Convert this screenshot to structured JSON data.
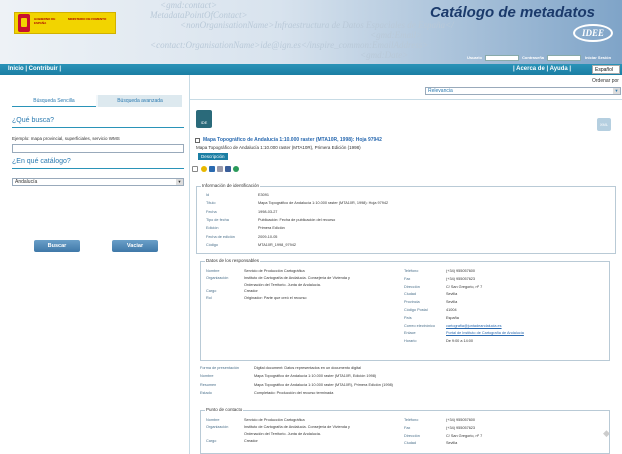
{
  "header": {
    "xml_lines": [
      "<gmd:contact>",
      "MetadataPointOfContact>",
      "<nonOrganisationName>Infraestructura de Datos Espaciales de España</",
      "<gmd:Email>",
      "<contact:OrganisationName>ide@ign.es</inspire_common:EmailAddress>",
      "<gmd:Date>"
    ],
    "logo_line1": "GOBIERNO DE ESPAÑA",
    "logo_line2": "MINISTERIO DE FOMENTO",
    "title": "Catálogo de metadatos",
    "idee": "IDEE",
    "login": {
      "user_label": "Usuario",
      "pass_label": "Contraseña",
      "login_link": "Iniciar Sesión"
    }
  },
  "nav": {
    "left": "Inicio | Contribuir |",
    "right": "| Acerca de | Ayuda |",
    "lang": "Español"
  },
  "left": {
    "tabs": [
      "Búsqueda Sencilla",
      "Búsqueda avanzada"
    ],
    "q1": "¿Qué busca?",
    "example": "Ejemplo: mapa provincial, superficiales, servicio WMS",
    "search_value": "",
    "q2": "¿En qué catálogo?",
    "catalog": "Andalucía",
    "btn_search": "Buscar",
    "btn_clear": "Vaciar"
  },
  "right": {
    "order_label": "Ordenar por",
    "order_value": "Relevancia",
    "doc_icon": "IDE",
    "xml_icon": "XML",
    "result_title": "Mapa Topográfico de Andalucía 1:10.000 raster (MTA10R, 1998): Hoja 97942",
    "result_sub": "Mapa Topográfico de Andalucía 1:10.000 raster (MTA10R), Primera Edición (1998)",
    "desc_button": "Descripción",
    "ident": {
      "legend": "Información de identificación",
      "rows": [
        {
          "k": "Id",
          "v": "E3091"
        },
        {
          "k": "Título",
          "v": "Mapa Topográfico de Andalucía 1:10.000 raster (MTA10R, 1998): Hoja 97942"
        },
        {
          "k": "Fecha",
          "v": "1998-03-27"
        },
        {
          "k": "Tipo de fecha",
          "v": "Publicación: Fecha de publicación del recurso"
        },
        {
          "k": "Edición",
          "v": "Primera Edición"
        },
        {
          "k": "Fecha de edición",
          "v": "2009-10-05"
        },
        {
          "k": "Código",
          "v": "MTA10R_1998_97942"
        }
      ]
    },
    "resp": {
      "legend": "Datos de los responsables",
      "left": [
        {
          "k": "Nombre",
          "v": "Servicio de Producción Cartográfica"
        },
        {
          "k": "Organización",
          "v": "Instituto de Cartografía de Andalucía. Consejería de Vivienda y"
        },
        {
          "k": "",
          "v": "Ordenación del Territorio. Junta de Andalucía."
        },
        {
          "k": "Cargo",
          "v": "Creador"
        },
        {
          "k": "Rol",
          "v": "Originador: Parte que creó el recurso"
        }
      ],
      "right": [
        {
          "k": "Teléfono",
          "v": "(+34) 955057600"
        },
        {
          "k": "Fax",
          "v": "(+34) 955057623"
        },
        {
          "k": "Dirección",
          "v": "C/ San Gregorio, nº 7"
        },
        {
          "k": "Ciudad",
          "v": "Sevilla"
        },
        {
          "k": "Provincia",
          "v": "Sevilla"
        },
        {
          "k": "Código Postal",
          "v": "41004"
        },
        {
          "k": "País",
          "v": "España"
        },
        {
          "k": "Correo electrónico",
          "v": "cartografia@juntadeandalucia.es"
        },
        {
          "k": "Enlace",
          "v": "Portal de Instituto de Cartografía de Andalucía"
        },
        {
          "k": "Horario",
          "v": "De 9:00 a 14:00"
        }
      ]
    },
    "extra": [
      {
        "k": "Forma de presentación",
        "v": "Digital document: Datos representados en un documento digital"
      },
      {
        "k": "Nombre",
        "v": "Mapa Topográfico de Andalucía 1:10.000 raster (MTA10R, Edición 1998)"
      },
      {
        "k": "Resumen",
        "v": "Mapa Topográfico de Andalucía 1:10.000 raster (MTA10R), Primera Edición (1998)"
      },
      {
        "k": "Estado",
        "v": "Completado: Producción del recurso terminada"
      }
    ],
    "contact": {
      "legend": "Punto de contacto",
      "left": [
        {
          "k": "Nombre",
          "v": "Servicio de Producción Cartográfica"
        },
        {
          "k": "Organización",
          "v": "Instituto de Cartografía de Andalucía. Consejería de Vivienda y"
        },
        {
          "k": "",
          "v": "Ordenación del Territorio. Junta de Andalucía."
        },
        {
          "k": "Cargo",
          "v": "Creador"
        }
      ],
      "right": [
        {
          "k": "Teléfono",
          "v": "(+34) 955057600"
        },
        {
          "k": "Fax",
          "v": "(+34) 955057623"
        },
        {
          "k": "Dirección",
          "v": "C/ San Gregorio, nº 7"
        },
        {
          "k": "Ciudad",
          "v": "Sevilla"
        }
      ]
    }
  }
}
